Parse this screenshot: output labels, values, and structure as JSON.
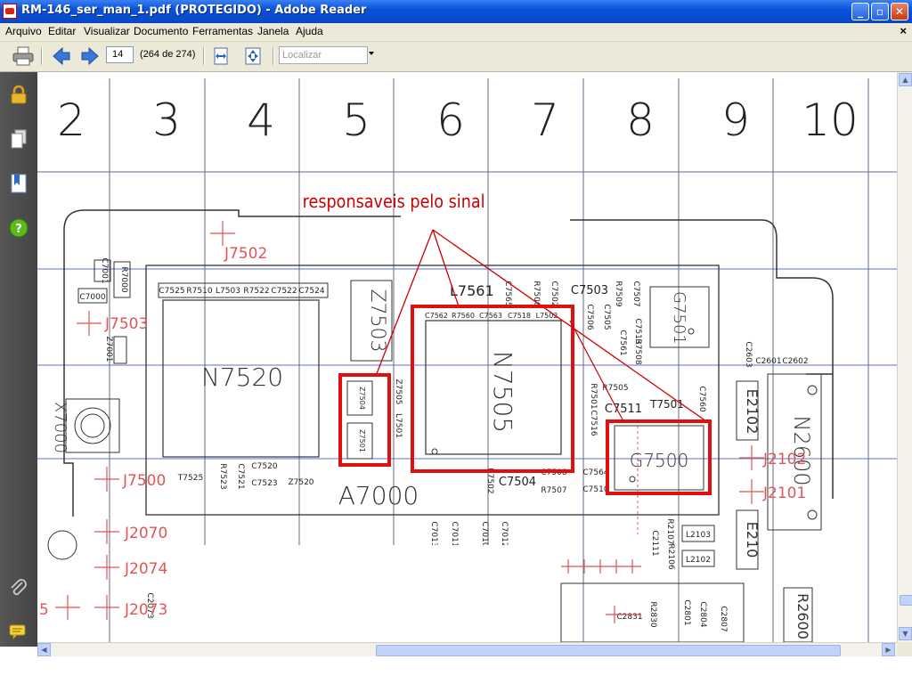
{
  "window": {
    "title": "RM-146_ser_man_1.pdf (PROTEGIDO) - Adobe Reader",
    "minimize": "_",
    "maximize": "▫",
    "close": "✕"
  },
  "menu": {
    "items": [
      "Arquivo",
      "Editar",
      "Visualizar",
      "Documento",
      "Ferramentas",
      "Janela",
      "Ajuda"
    ],
    "close": "×"
  },
  "toolbar": {
    "page_number": "14",
    "page_count": "(264 de 274)",
    "find_placeholder": "Localizar"
  },
  "sidebar": {
    "icons": [
      "lock-icon",
      "pages-icon",
      "bookmarks-icon",
      "help-icon",
      "attachment-icon",
      "comments-icon"
    ]
  },
  "schematic": {
    "columns": [
      "2",
      "3",
      "4",
      "5",
      "6",
      "7",
      "8",
      "9",
      "10"
    ],
    "annotation": "responsaveis pelo sinal",
    "annotation_color": "#cc0000",
    "markup_color": "#e01010",
    "ref_color": "#e05555",
    "chips": {
      "n7520": "N7520",
      "n7505": "N7505",
      "z7503": "Z7503",
      "g7501": "G7501",
      "g7500": "G7500",
      "n2600": "N2600",
      "x7000": "X7000",
      "z7504": "Z7504",
      "z7501": "Z7501",
      "a7000": "A7000",
      "r2600": "R2600",
      "e2102": "E2102",
      "e2101": "E210"
    },
    "red_refs": {
      "j7502": "J7502",
      "j7503": "J7503",
      "j7500": "J7500",
      "j2070": "J2070",
      "j2074": "J2074",
      "j2073": "J2073",
      "j2102": "J2102",
      "j2101": "J2101",
      "edge5": "5"
    },
    "labels": {
      "c7001": "C7001",
      "r7000": "R7000",
      "c7000": "C7000",
      "z7001": "Z7001",
      "c7525": "C7525",
      "r7510": "R7510",
      "l7503": "L7503",
      "r7522": "R7522",
      "c7522": "C7522",
      "c7524": "C7524",
      "l7561": "L7561",
      "c7565": "C7565",
      "r7506": "R7506",
      "c7502": "C7502",
      "c7503": "C7503",
      "r7509": "R7509",
      "c7507": "C7507",
      "c7562": "C7562",
      "r7560": "R7560",
      "c7563": "C7563",
      "c7518": "C7518",
      "l7502": "L7502",
      "c7513": "C7513",
      "r7508": "R7508",
      "c7505": "C7505",
      "c7506": "C7506",
      "c7561": "C7561",
      "r7505": "R7505",
      "c7511": "C7511",
      "t7501": "T7501",
      "c7560": "C7560",
      "c2603": "C2603",
      "c2601": "C2601",
      "c2602": "C2602",
      "r7501": "R7501",
      "c7516": "C7516",
      "z7505": "Z7505",
      "l7501": "L7501",
      "c7504": "C7504",
      "r7507": "R7507",
      "c7508": "C7508",
      "r7502": "R7502",
      "c7564": "C7564",
      "c7510": "C7510",
      "t7525": "T7525",
      "r7523": "R7523",
      "c7521": "C7521",
      "c7520": "C7520",
      "c7523": "C7523",
      "z7520": "Z7520",
      "c7013": "C7013",
      "c7011": "C7011",
      "c7010": "C7010",
      "c7012": "C7012",
      "r2107": "R2107",
      "r2106": "R2106",
      "c2111": "C2111",
      "l2103": "L2103",
      "l2102": "L2102",
      "c2831": "C2831",
      "r2830": "R2830",
      "c2801": "C2801",
      "c2804": "C2804",
      "c2807": "C2807",
      "c2073": "C2073"
    }
  }
}
